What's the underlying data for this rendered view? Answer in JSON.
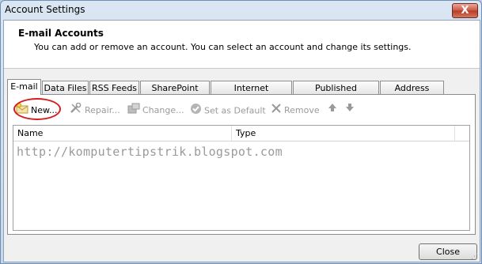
{
  "window": {
    "title": "Account Settings",
    "close_glyph": "X"
  },
  "header": {
    "title": "E-mail Accounts",
    "description": "You can add or remove an account. You can select an account and change its settings."
  },
  "tabs": [
    {
      "label": "E-mail",
      "active": true
    },
    {
      "label": "Data Files"
    },
    {
      "label": "RSS Feeds"
    },
    {
      "label": "SharePoint Lists"
    },
    {
      "label": "Internet Calendars"
    },
    {
      "label": "Published Calendars"
    },
    {
      "label": "Address Books"
    }
  ],
  "toolbar": {
    "new": "New...",
    "repair": "Repair...",
    "change": "Change...",
    "set_default": "Set as Default",
    "remove": "Remove"
  },
  "list": {
    "columns": [
      "Name",
      "Type"
    ],
    "watermark": "http://komputertipstrik.blogspot.com"
  },
  "footer": {
    "close": "Close"
  },
  "colors": {
    "highlight_circle": "#d21f1f",
    "disabled_text": "#9a9a9a"
  }
}
